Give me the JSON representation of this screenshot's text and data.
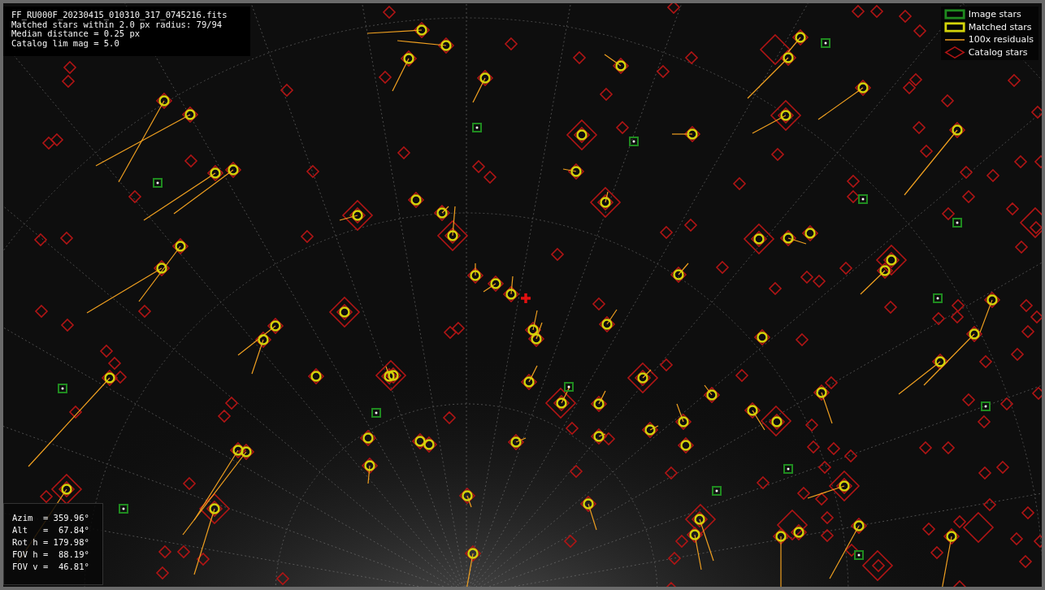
{
  "info_box": {
    "lines": [
      "FF_RU000F_20230415_010310_317_0745216.fits",
      "Matched stars within 2.0 px radius: 79/94",
      "Median distance = 0.25 px",
      "Catalog lim mag = 5.0"
    ]
  },
  "legend": {
    "items": [
      {
        "kind": "image",
        "label": "Image stars"
      },
      {
        "kind": "matched",
        "label": "Matched stars"
      },
      {
        "kind": "residual",
        "label": "100x residuals"
      },
      {
        "kind": "catalog",
        "label": "Catalog stars"
      }
    ]
  },
  "pointing_box": {
    "lines": [
      "Azim  = 359.96°",
      "Alt   =  67.84°",
      "Rot h = 179.98°",
      "FOV h =  88.19°",
      "FOV v =  46.81°"
    ]
  }
}
